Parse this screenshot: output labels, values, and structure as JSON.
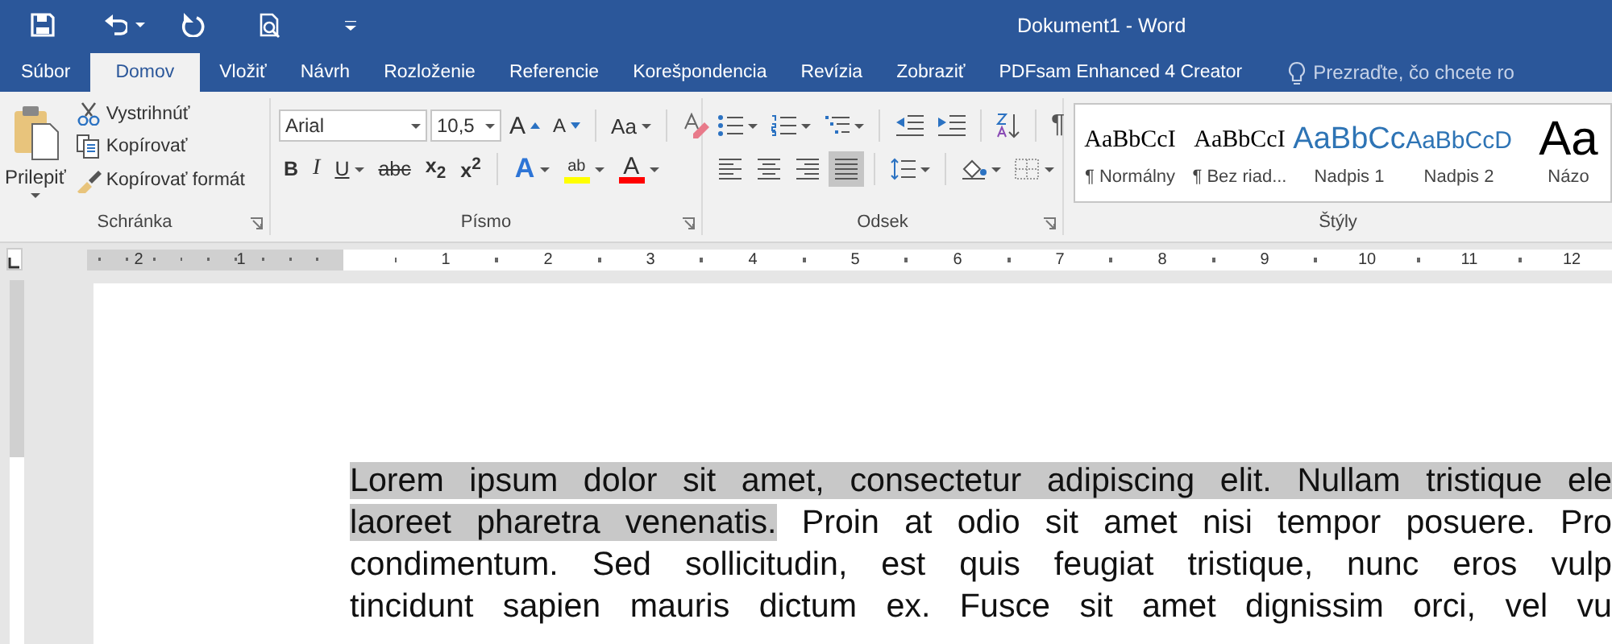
{
  "window": {
    "title": "Dokument1 - Word"
  },
  "tabs": [
    {
      "label": "Súbor",
      "selected": false
    },
    {
      "label": "Domov",
      "selected": true
    },
    {
      "label": "Vložiť",
      "selected": false
    },
    {
      "label": "Návrh",
      "selected": false
    },
    {
      "label": "Rozloženie",
      "selected": false
    },
    {
      "label": "Referencie",
      "selected": false
    },
    {
      "label": "Korešpondencia",
      "selected": false
    },
    {
      "label": "Revízia",
      "selected": false
    },
    {
      "label": "Zobraziť",
      "selected": false
    },
    {
      "label": "PDFsam Enhanced 4 Creator",
      "selected": false
    }
  ],
  "tell_me": {
    "placeholder": "Prezraďte, čo chcete ro"
  },
  "clipboard": {
    "label": "Schránka",
    "paste": "Prilepiť",
    "items": [
      {
        "kind": "cut",
        "label": "Vystrihnúť"
      },
      {
        "kind": "copy",
        "label": "Kopírovať"
      },
      {
        "kind": "format",
        "label": "Kopírovať formát"
      }
    ]
  },
  "font": {
    "label": "Písmo",
    "font_name": "Arial",
    "font_size": "10,5",
    "grow": "A",
    "shrink": "A",
    "change_case": "Aa",
    "buttons": [
      {
        "kind": "bold",
        "label": "B"
      },
      {
        "kind": "italic",
        "label": "I"
      },
      {
        "kind": "underline",
        "label": "U"
      },
      {
        "kind": "strike",
        "label": "abc"
      },
      {
        "kind": "sub",
        "label": "x$_{2}$"
      },
      {
        "kind": "sup",
        "label": "x$^{2}$"
      }
    ],
    "color_buttons": [
      {
        "kind": "effects",
        "label": "A",
        "color": "#2e75d6"
      },
      {
        "kind": "highlight",
        "label": "ab",
        "color": "#ffff00"
      },
      {
        "kind": "font-color",
        "label": "A",
        "color": "#ff0000"
      }
    ]
  },
  "paragraph": {
    "label": "Odsek",
    "show_marks": "¶",
    "alignment": [
      {
        "kind": "left",
        "selected": false
      },
      {
        "kind": "center",
        "selected": false
      },
      {
        "kind": "right",
        "selected": false
      },
      {
        "kind": "justify",
        "selected": true
      }
    ]
  },
  "styles": {
    "label": "Štýly",
    "items": [
      {
        "kind": "normal",
        "sample": "AaBbCcI",
        "name": "¶ Normálny"
      },
      {
        "kind": "nospacing",
        "sample": "AaBbCcI",
        "name": "¶ Bez riad..."
      },
      {
        "kind": "heading1",
        "sample": "AaBbCc",
        "name": "Nadpis 1"
      },
      {
        "kind": "heading2",
        "sample": "AaBbCcD",
        "name": "Nadpis 2"
      },
      {
        "kind": "title",
        "sample": "Aa",
        "name": "Názo"
      }
    ]
  },
  "ruler": {
    "left_numbers": [
      "2",
      "1"
    ],
    "right_numbers": [
      "1",
      "2",
      "3",
      "4",
      "5",
      "6",
      "7",
      "8",
      "9",
      "10",
      "11",
      "12"
    ]
  },
  "document": {
    "lines": [
      [
        {
          "text": "Lorem ipsum dolor sit amet, consectetur adipiscing elit. Nullam tristique ele",
          "selected": true
        }
      ],
      [
        {
          "text": "laoreet pharetra venenatis.",
          "selected": true
        },
        {
          "text": " Proin at odio sit amet nisi tempor posuere. Pro",
          "selected": false
        }
      ],
      [
        {
          "text": "condimentum. Sed sollicitudin, est quis feugiat tristique, nunc eros vulp",
          "selected": false
        }
      ],
      [
        {
          "text": "tincidunt sapien mauris dictum ex. Fusce sit amet dignissim orci, vel vu",
          "selected": false
        }
      ]
    ]
  }
}
